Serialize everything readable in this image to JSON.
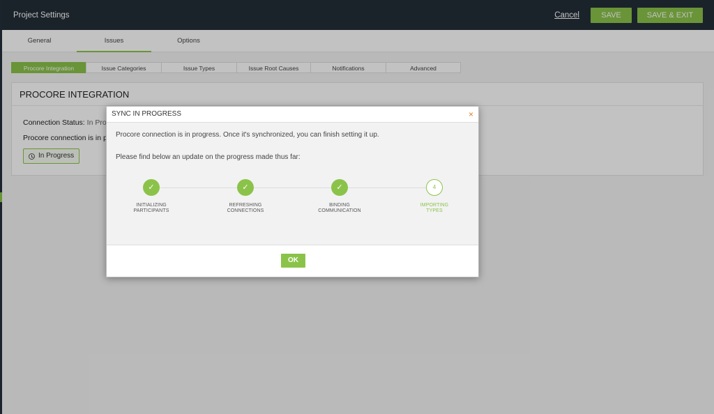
{
  "header": {
    "title": "Project Settings",
    "cancel_label": "Cancel",
    "save_label": "SAVE",
    "save_exit_label": "SAVE & EXIT"
  },
  "tabs": [
    {
      "label": "General",
      "active": false
    },
    {
      "label": "Issues",
      "active": true
    },
    {
      "label": "Options",
      "active": false
    }
  ],
  "subtabs": [
    {
      "label": "Procore Integration",
      "active": true
    },
    {
      "label": "Issue Categories",
      "active": false
    },
    {
      "label": "Issue Types",
      "active": false
    },
    {
      "label": "Issue Root Causes",
      "active": false
    },
    {
      "label": "Notifications",
      "active": false
    },
    {
      "label": "Advanced",
      "active": false
    }
  ],
  "card": {
    "title": "PROCORE INTEGRATION",
    "status_label": "Connection Status:",
    "status_value": "In Pro",
    "connection_text": "Procore connection is in p",
    "status_button": "In Progress"
  },
  "modal": {
    "title": "SYNC IN PROGRESS",
    "close_icon": "×",
    "message": "Procore connection is in progress. Once it's synchronized, you can finish setting it up.",
    "progress_intro": "Please find below an update on the progress made thus far:",
    "steps": [
      {
        "line1": "INITIALIZING",
        "line2": "PARTICIPANTS",
        "state": "done",
        "marker": "✓"
      },
      {
        "line1": "REFRESHING",
        "line2": "CONNECTIONS",
        "state": "done",
        "marker": "✓"
      },
      {
        "line1": "BINDING",
        "line2": "COMMUNICATION",
        "state": "done",
        "marker": "✓"
      },
      {
        "line1": "IMPORTING",
        "line2": "TYPES",
        "state": "pending",
        "marker": "4"
      }
    ],
    "ok_label": "OK"
  },
  "colors": {
    "accent": "#8bc34a",
    "topbar": "#242f38",
    "close": "#e67e22"
  }
}
